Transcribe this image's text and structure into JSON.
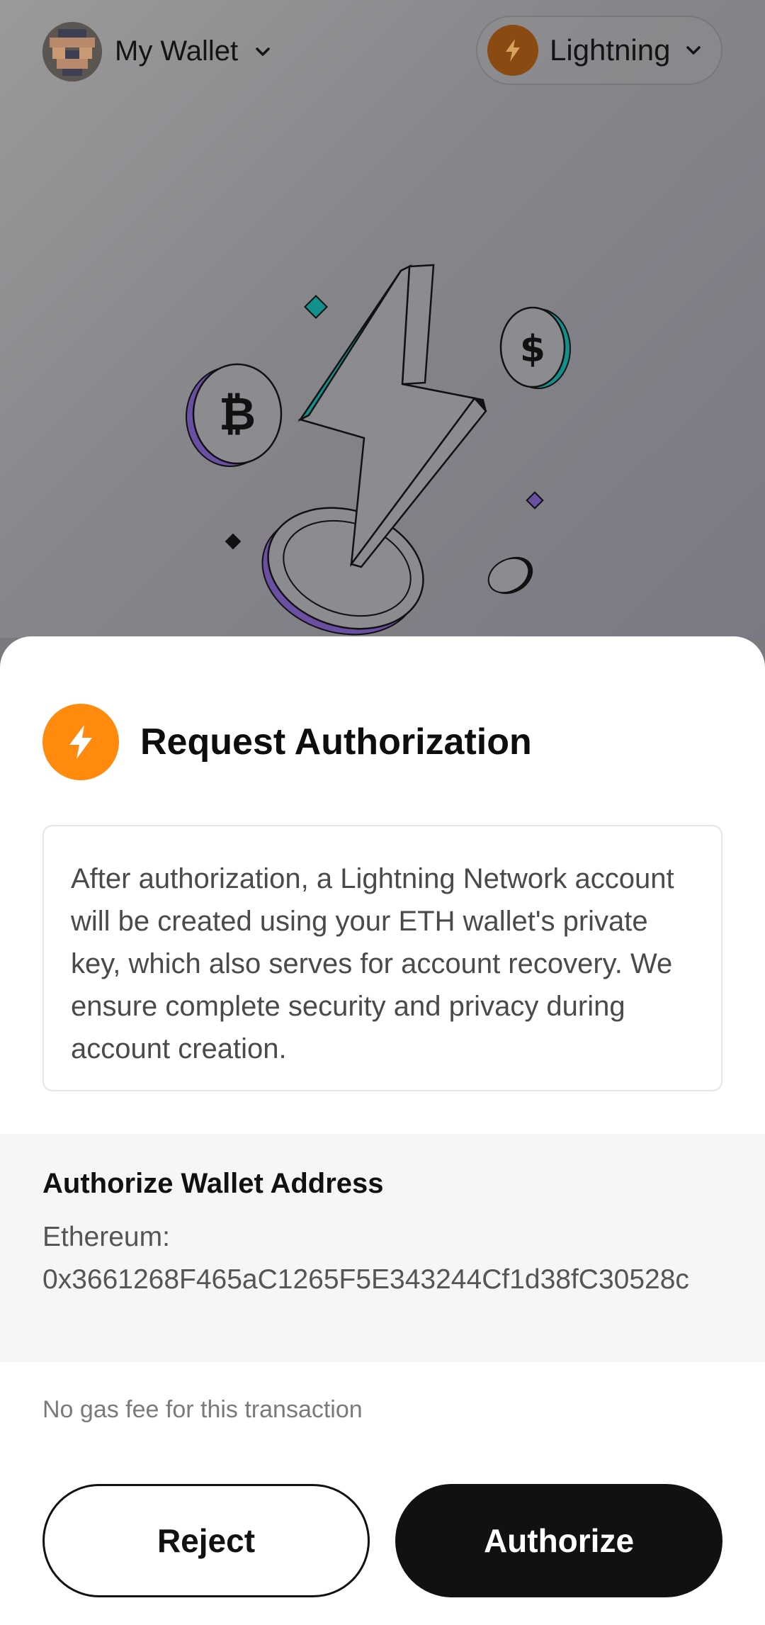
{
  "header": {
    "wallet_name": "My Wallet",
    "network_name": "Lightning"
  },
  "dialog": {
    "title": "Request Authorization",
    "description": "After authorization, a Lightning Network account will be created using your ETH wallet's private key, which also serves for account recovery. We ensure complete security and privacy during account creation.",
    "address_label": "Authorize Wallet Address",
    "address_chain": "Ethereum:",
    "address_value": "0x3661268F465aC1265F5E343244Cf1d38fC30528c",
    "gas_note": "No gas fee for this transaction",
    "reject_label": "Reject",
    "authorize_label": "Authorize"
  },
  "colors": {
    "accent_orange": "#ff8a0d",
    "teal": "#12908e",
    "purple": "#6a4fa3",
    "primary_button": "#111111"
  },
  "icons": {
    "network": "lightning-bolt-icon",
    "chevron": "chevron-down-icon",
    "illustration": [
      "bitcoin-coin-icon",
      "dollar-coin-icon",
      "lightning-bolt-illustration"
    ]
  }
}
